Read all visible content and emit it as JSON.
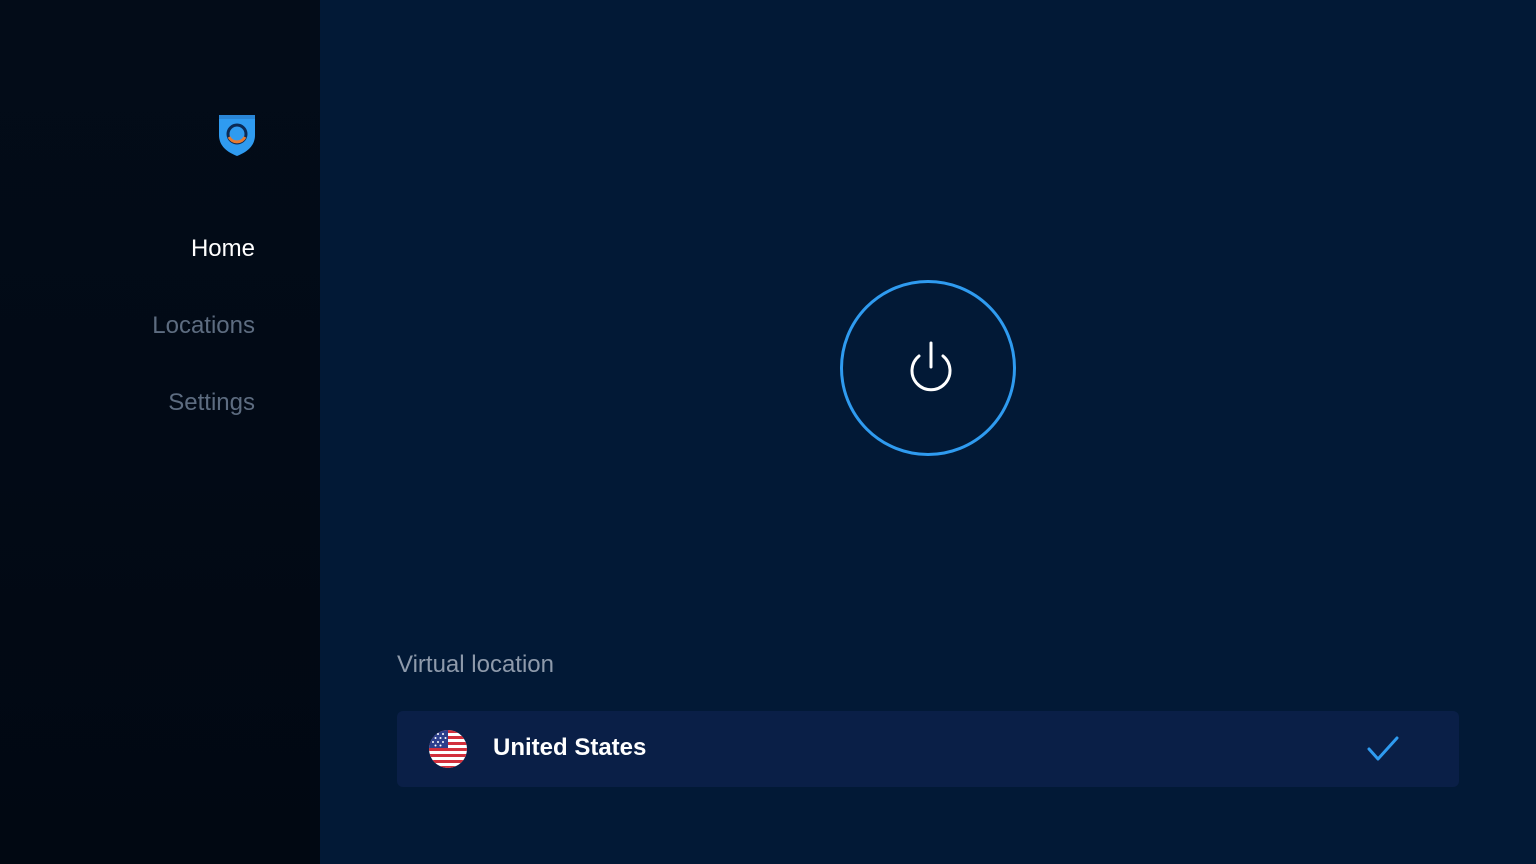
{
  "sidebar": {
    "logo_icon": "hotspot-shield-logo",
    "items": [
      {
        "label": "Home",
        "active": true
      },
      {
        "label": "Locations",
        "active": false
      },
      {
        "label": "Settings",
        "active": false
      }
    ]
  },
  "main": {
    "power_button": {
      "icon": "power-icon",
      "ring_color": "#2f9bf0"
    },
    "virtual_location": {
      "label": "Virtual location",
      "selected": {
        "name": "United States",
        "flag_icon": "us-flag-icon",
        "check_icon": "checkmark-icon"
      }
    }
  },
  "colors": {
    "background": "#021936",
    "sidebar": "#020a16",
    "accent": "#2f9bf0",
    "row_bg": "#0a1f47",
    "inactive_text": "#5d6c80"
  }
}
